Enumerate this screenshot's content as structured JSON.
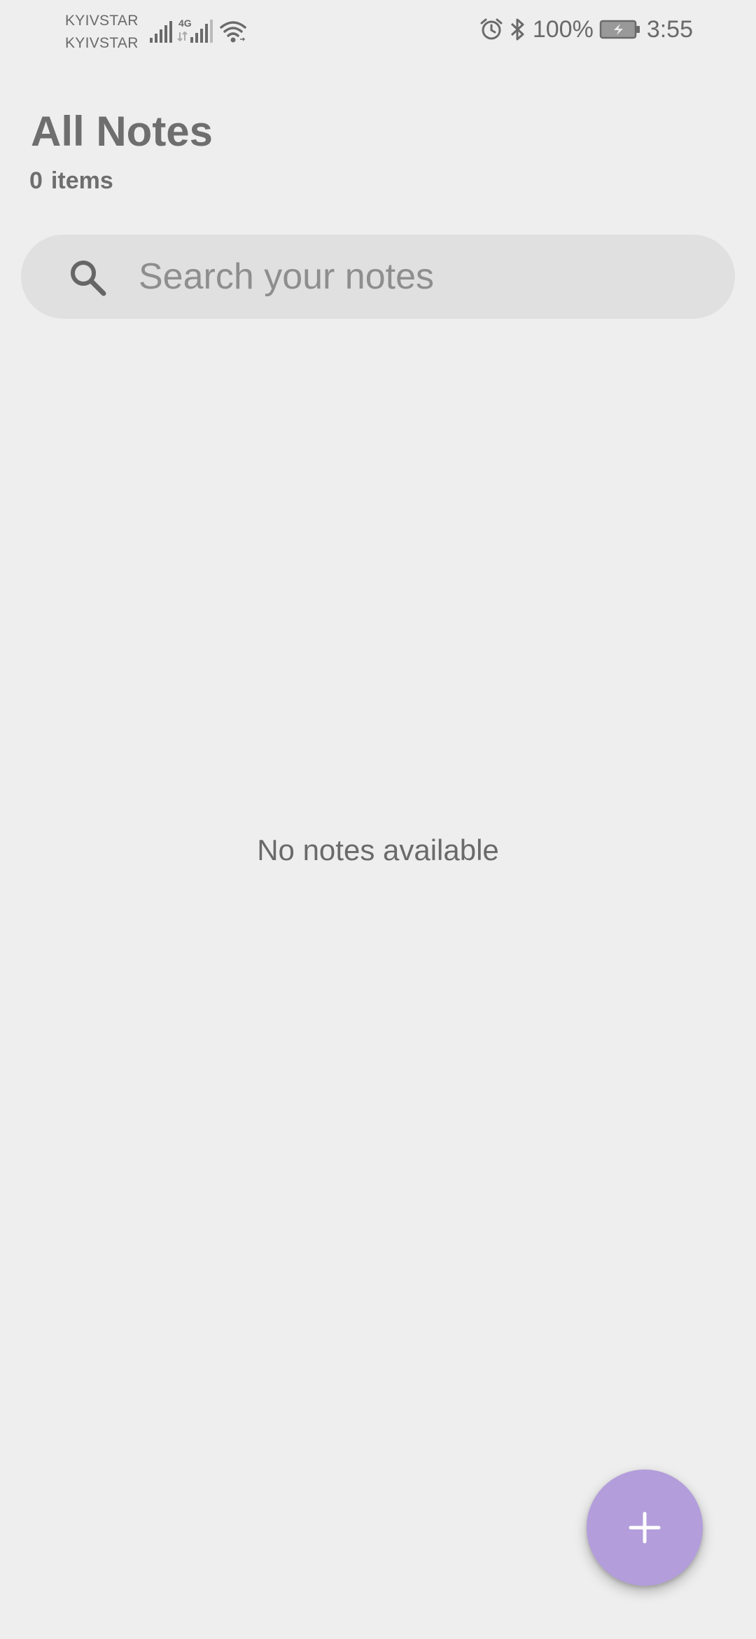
{
  "status_bar": {
    "carrier_1": "KYIVSTAR",
    "carrier_2": "KYIVSTAR",
    "network_type": "4G",
    "battery_percent": "100%",
    "time": "3:55",
    "icons": [
      "signal-icon",
      "signal-4g-icon",
      "wifi-icon",
      "alarm-icon",
      "bluetooth-icon",
      "battery-charging-icon"
    ]
  },
  "header": {
    "title": "All Notes",
    "count_number": "0",
    "count_label": "items"
  },
  "search": {
    "placeholder": "Search your notes",
    "value": "",
    "icon": "search-icon"
  },
  "empty_state": {
    "message": "No notes available"
  },
  "fab": {
    "icon": "plus-icon",
    "color": "#b39ddb"
  },
  "colors": {
    "background": "#eeeeee",
    "search_background": "#e0e0e0",
    "text": "#6e6e6e",
    "accent": "#b39ddb"
  }
}
